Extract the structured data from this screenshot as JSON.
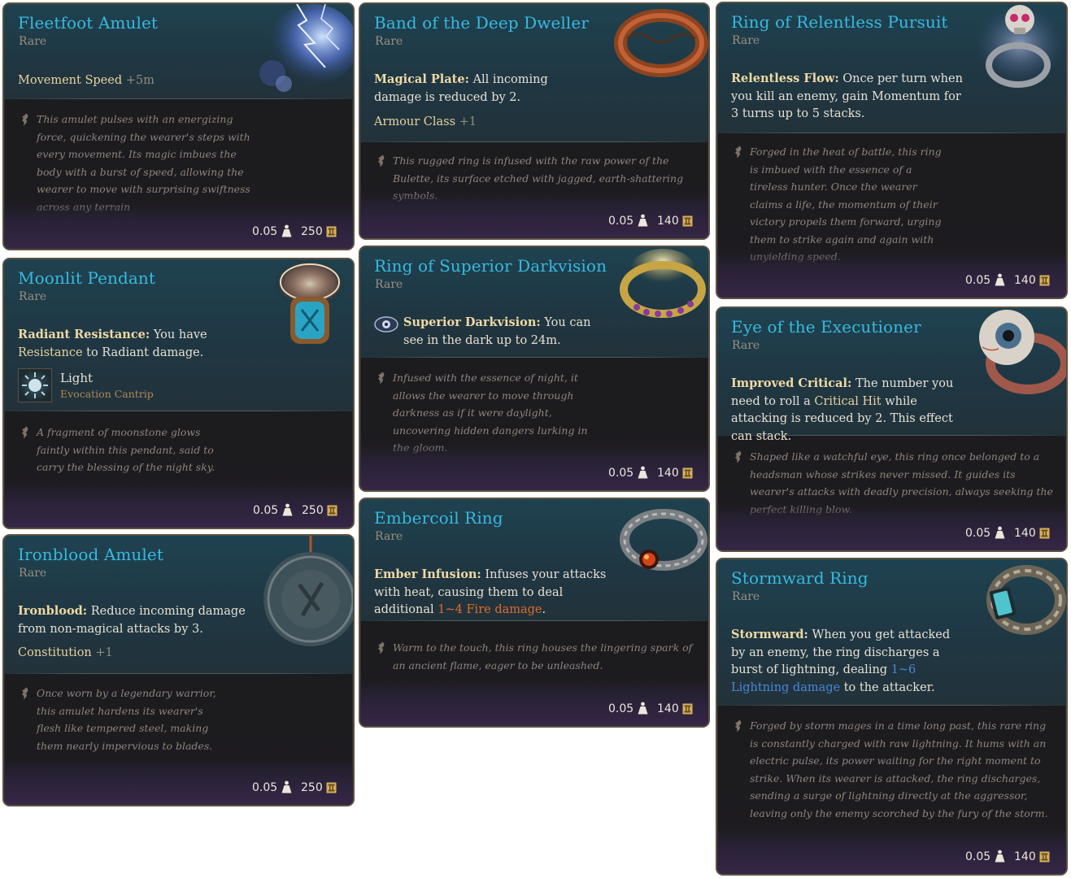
{
  "icons": {
    "weight": "weight-icon",
    "gold": "gold-coin-icon",
    "lore": "quill-icon"
  },
  "colors": {
    "name": "#37b9e0",
    "rarity": "#9a8f80",
    "accent": "#e9d29f",
    "fire": "#e06a2c",
    "lightning": "#4a86d6"
  },
  "cards": {
    "fleetfoot": {
      "name": "Fleetfoot Amulet",
      "rarity": "Rare",
      "stat": "Movement Speed",
      "stat_bonus": "+5m",
      "lore": "This amulet pulses with an energizing force, quickening the wearer's steps with every movement. Its magic imbues the body with a burst of speed, allowing the wearer to move with surprising swiftness across any terrain",
      "weight": "0.05",
      "value": "250"
    },
    "moonlit": {
      "name": "Moonlit Pendant",
      "rarity": "Rare",
      "prop_title": "Radiant Resistance:",
      "prop_pre": "You have",
      "prop_hl": "Resistance",
      "prop_post": "to Radiant damage.",
      "spell_name": "Light",
      "spell_sub": "Evocation Cantrip",
      "lore": "A fragment of moonstone glows faintly within this pendant, said to carry the blessing of the night sky.",
      "weight": "0.05",
      "value": "250"
    },
    "ironblood": {
      "name": "Ironblood Amulet",
      "rarity": "Rare",
      "prop_title": "Ironblood:",
      "prop_text": "Reduce incoming damage from non-magical attacks by 3.",
      "stat": "Constitution",
      "stat_bonus": "+1",
      "lore": "Once worn by a legendary warrior, this amulet hardens its wearer's flesh like tempered steel, making them nearly impervious to blades.",
      "weight": "0.05",
      "value": "250"
    },
    "deep_dweller": {
      "name": "Band of the Deep Dweller",
      "rarity": "Rare",
      "prop_title": "Magical Plate:",
      "prop_text": "All incoming damage is reduced by 2.",
      "stat": "Armour Class",
      "stat_bonus": "+1",
      "lore": "This rugged ring is infused with the raw power of the Bulette, its surface etched with jagged, earth-shattering symbols.",
      "weight": "0.05",
      "value": "140"
    },
    "darkvision": {
      "name": "Ring of Superior Darkvision",
      "rarity": "Rare",
      "prop_title": "Superior Darkvision:",
      "prop_text": "You can see in the dark up to 24m.",
      "lore": "Infused with the essence of night, it allows the wearer to move through darkness as if it were daylight, uncovering hidden dangers lurking in the gloom.",
      "weight": "0.05",
      "value": "140"
    },
    "embercoil": {
      "name": "Embercoil Ring",
      "rarity": "Rare",
      "prop_title": "Ember Infusion:",
      "prop_text": "Infuses your attacks with heat, causing them to deal additional",
      "prop_dmg": "1~4",
      "prop_dmg_type": "Fire damage",
      "prop_end": ".",
      "lore": "Warm to the touch, this ring houses the lingering spark of an ancient flame, eager to be unleashed.",
      "weight": "0.05",
      "value": "140"
    },
    "relentless": {
      "name": "Ring of Relentless Pursuit",
      "rarity": "Rare",
      "prop_title": "Relentless Flow:",
      "prop_text": "Once per turn when you kill an enemy, gain Momentum for 3 turns up to 5 stacks.",
      "lore": "Forged in the heat of battle, this ring is imbued with the essence of a tireless hunter. Once the wearer claims a life, the momentum of their victory propels them forward, urging them to strike again and again with unyielding speed.",
      "weight": "0.05",
      "value": "140"
    },
    "executioner": {
      "name": "Eye of the Executioner",
      "rarity": "Rare",
      "prop_title": "Improved Critical:",
      "prop_pre": "The number you need to roll a",
      "prop_hl": "Critical Hit",
      "prop_post": "while attacking is reduced by 2. This effect can stack.",
      "lore": "Shaped like a watchful eye, this ring once belonged to a headsman whose strikes never missed. It guides its wearer's attacks with deadly precision, always seeking the perfect killing blow.",
      "weight": "0.05",
      "value": "140"
    },
    "stormward": {
      "name": "Stormward Ring",
      "rarity": "Rare",
      "prop_title": "Stormward:",
      "prop_text": "When you get attacked by an enemy, the ring discharges a burst of lightning, dealing",
      "prop_dmg": "1~6 Lightning damage",
      "prop_end": "to the attacker.",
      "lore": "Forged by storm mages in a time long past, this rare ring is constantly charged with raw lightning. It hums with an electric pulse, its power waiting for the right moment to strike. When its wearer is attacked, the ring discharges, sending a surge of lightning directly at the aggressor, leaving only the enemy scorched by the fury of the storm.",
      "weight": "0.05",
      "value": "140"
    }
  }
}
